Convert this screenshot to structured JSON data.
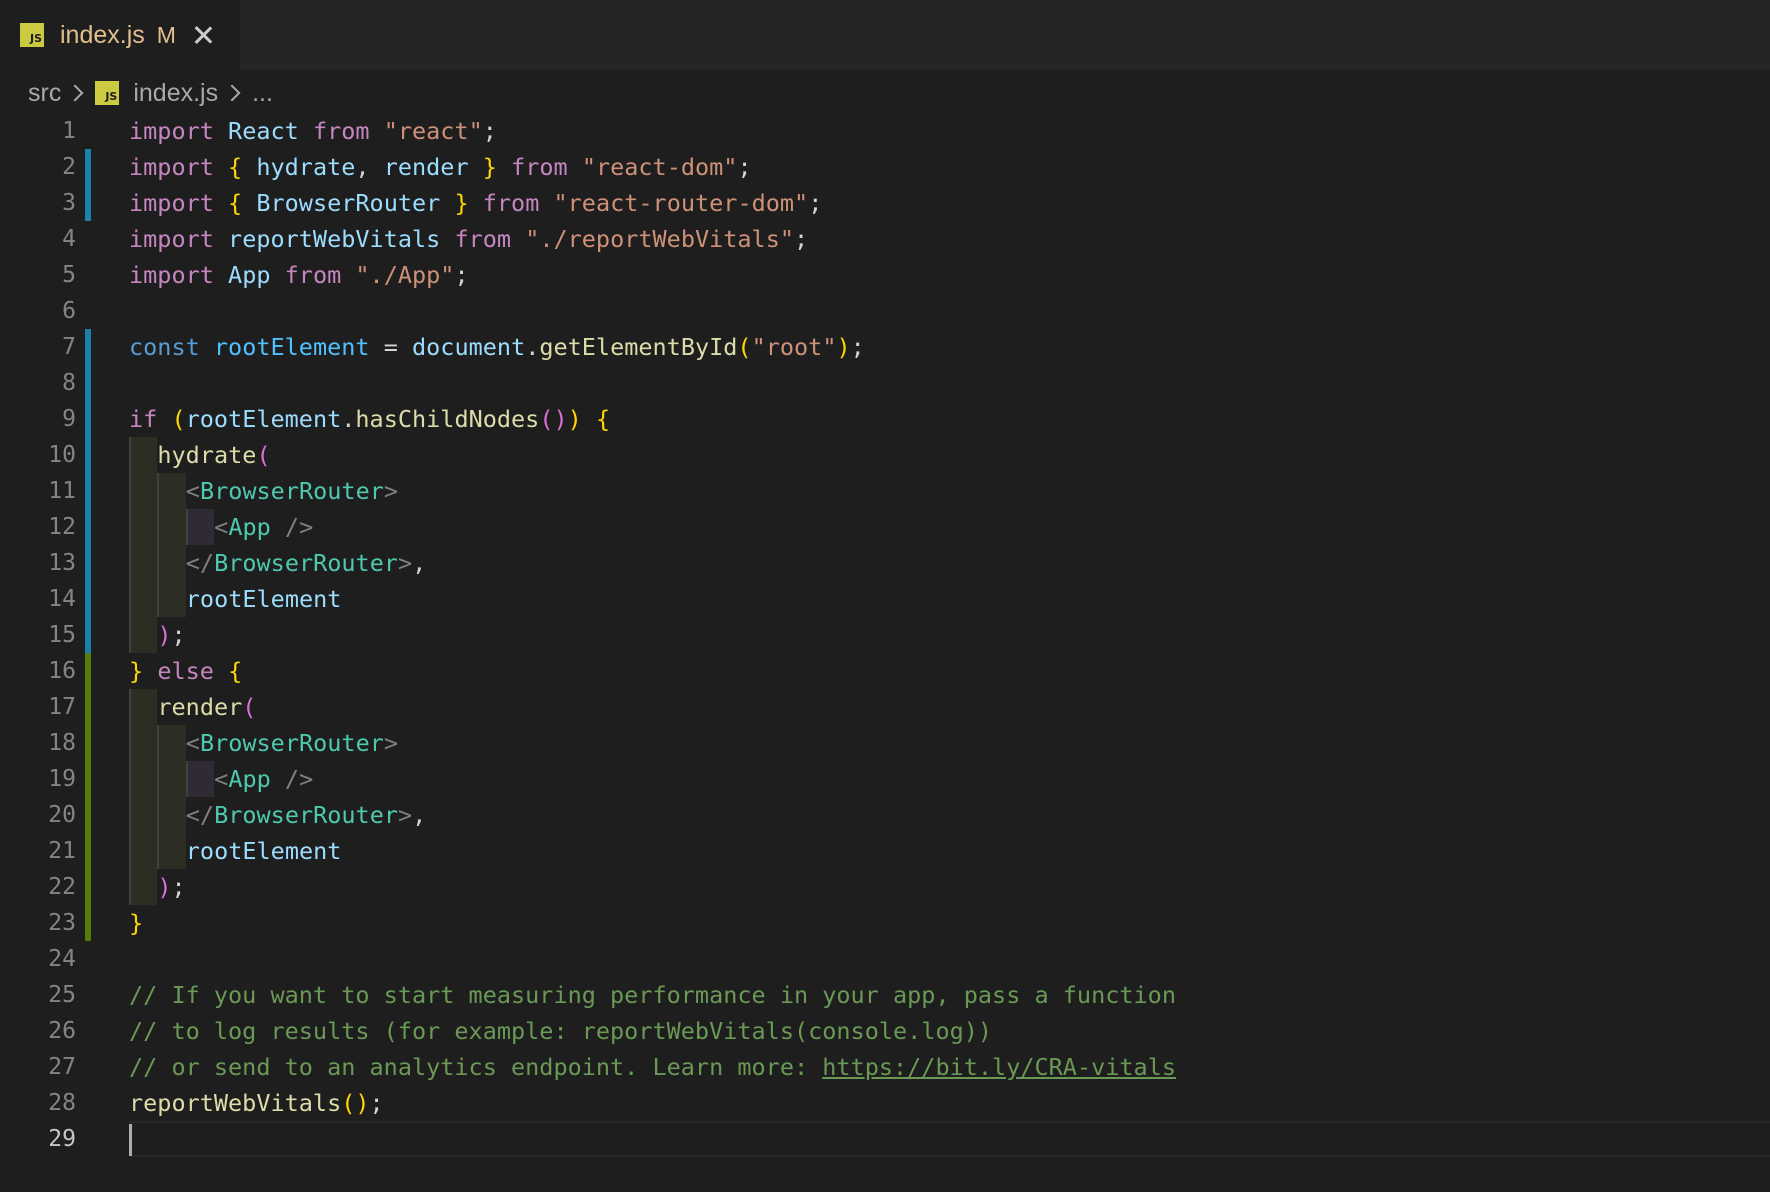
{
  "tab": {
    "icon": "js-file-icon",
    "icon_text": "JS",
    "filename": "index.js",
    "modified": "M"
  },
  "breadcrumb": {
    "folder": "src",
    "file": "index.js",
    "symbol": "..."
  },
  "gutter_colors": {
    "modified": "#1b81a8",
    "added": "#587c0c"
  },
  "editor": {
    "active_line": 29,
    "lines": [
      {
        "n": "1",
        "text": "import React from \"react\";"
      },
      {
        "n": "2",
        "text": "import { hydrate, render } from \"react-dom\";"
      },
      {
        "n": "3",
        "text": "import { BrowserRouter } from \"react-router-dom\";"
      },
      {
        "n": "4",
        "text": "import reportWebVitals from \"./reportWebVitals\";"
      },
      {
        "n": "5",
        "text": "import App from \"./App\";"
      },
      {
        "n": "6",
        "text": ""
      },
      {
        "n": "7",
        "text": "const rootElement = document.getElementById(\"root\");"
      },
      {
        "n": "8",
        "text": ""
      },
      {
        "n": "9",
        "text": "if (rootElement.hasChildNodes()) {"
      },
      {
        "n": "10",
        "text": "  hydrate("
      },
      {
        "n": "11",
        "text": "    <BrowserRouter>"
      },
      {
        "n": "12",
        "text": "      <App />"
      },
      {
        "n": "13",
        "text": "    </BrowserRouter>,"
      },
      {
        "n": "14",
        "text": "    rootElement"
      },
      {
        "n": "15",
        "text": "  );"
      },
      {
        "n": "16",
        "text": "} else {"
      },
      {
        "n": "17",
        "text": "  render("
      },
      {
        "n": "18",
        "text": "    <BrowserRouter>"
      },
      {
        "n": "19",
        "text": "      <App />"
      },
      {
        "n": "20",
        "text": "    </BrowserRouter>,"
      },
      {
        "n": "21",
        "text": "    rootElement"
      },
      {
        "n": "22",
        "text": "  );"
      },
      {
        "n": "23",
        "text": "}"
      },
      {
        "n": "24",
        "text": ""
      },
      {
        "n": "25",
        "text": "// If you want to start measuring performance in your app, pass a function"
      },
      {
        "n": "26",
        "text": "// to log results (for example: reportWebVitals(console.log))"
      },
      {
        "n": "27",
        "text": "// or send to an analytics endpoint. Learn more: https://bit.ly/CRA-vitals"
      },
      {
        "n": "28",
        "text": "reportWebVitals();"
      },
      {
        "n": "29",
        "text": ""
      }
    ]
  }
}
